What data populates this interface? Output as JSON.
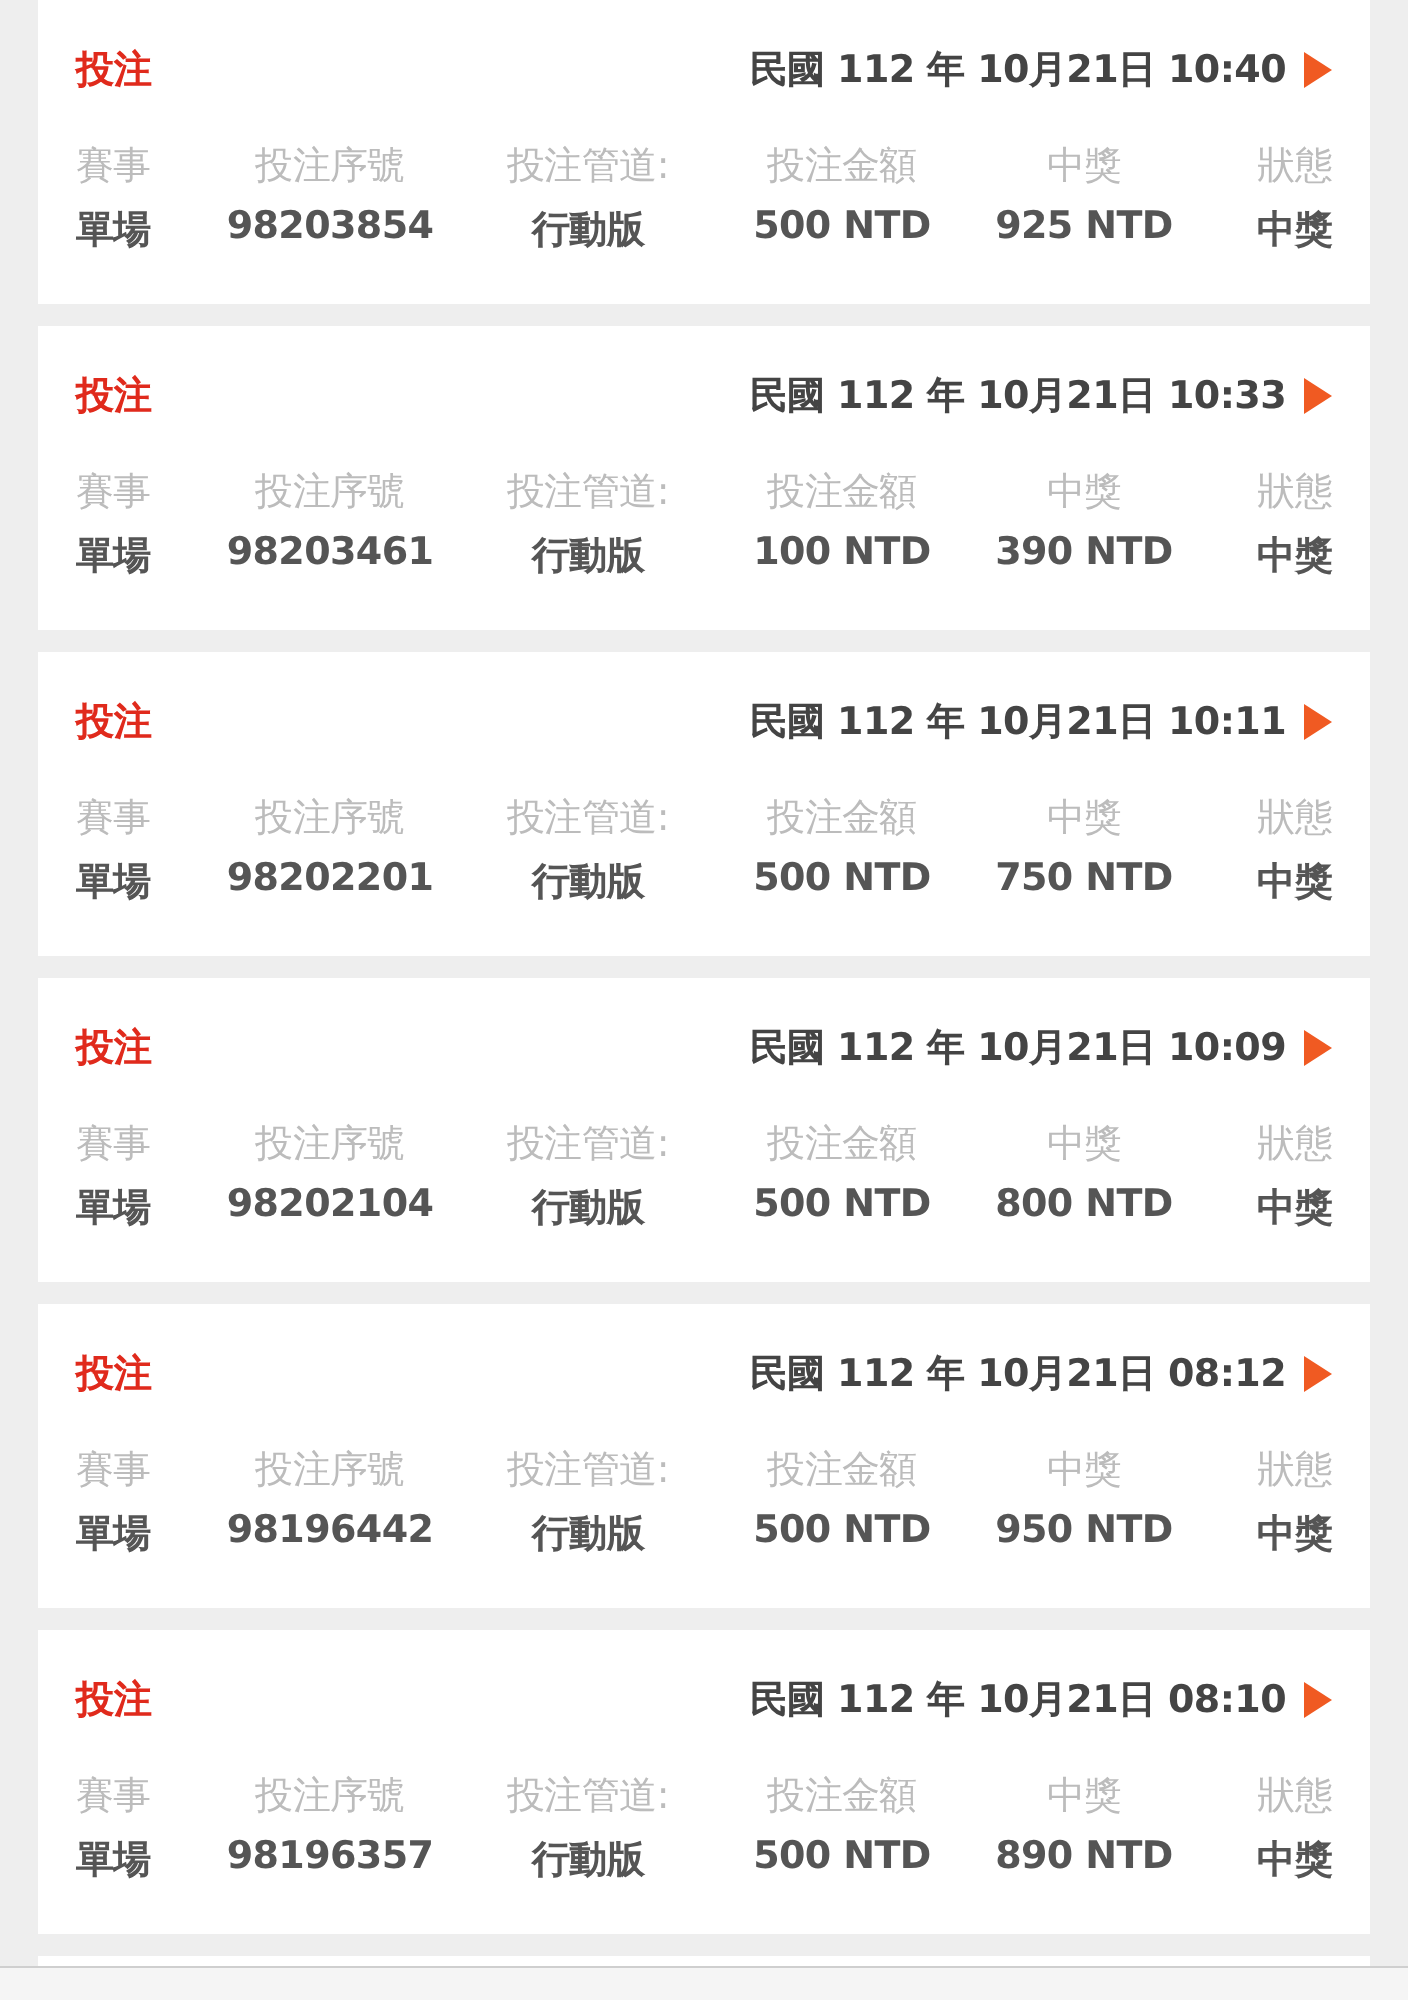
{
  "bets": [
    {
      "type": "投注",
      "datetime": "民國 112 年 10月21日 10:40",
      "columns": [
        "賽事",
        "投注序號",
        "投注管道:",
        "投注金額",
        "中獎",
        "狀態"
      ],
      "values": [
        "單場",
        "98203854",
        "行動版",
        "500 NTD",
        "925 NTD",
        "中獎"
      ]
    },
    {
      "type": "投注",
      "datetime": "民國 112 年 10月21日 10:33",
      "columns": [
        "賽事",
        "投注序號",
        "投注管道:",
        "投注金額",
        "中獎",
        "狀態"
      ],
      "values": [
        "單場",
        "98203461",
        "行動版",
        "100 NTD",
        "390 NTD",
        "中獎"
      ]
    },
    {
      "type": "投注",
      "datetime": "民國 112 年 10月21日 10:11",
      "columns": [
        "賽事",
        "投注序號",
        "投注管道:",
        "投注金額",
        "中獎",
        "狀態"
      ],
      "values": [
        "單場",
        "98202201",
        "行動版",
        "500 NTD",
        "750 NTD",
        "中獎"
      ]
    },
    {
      "type": "投注",
      "datetime": "民國 112 年 10月21日 10:09",
      "columns": [
        "賽事",
        "投注序號",
        "投注管道:",
        "投注金額",
        "中獎",
        "狀態"
      ],
      "values": [
        "單場",
        "98202104",
        "行動版",
        "500 NTD",
        "800 NTD",
        "中獎"
      ]
    },
    {
      "type": "投注",
      "datetime": "民國 112 年 10月21日 08:12",
      "columns": [
        "賽事",
        "投注序號",
        "投注管道:",
        "投注金額",
        "中獎",
        "狀態"
      ],
      "values": [
        "單場",
        "98196442",
        "行動版",
        "500 NTD",
        "950 NTD",
        "中獎"
      ]
    },
    {
      "type": "投注",
      "datetime": "民國 112 年 10月21日 08:10",
      "columns": [
        "賽事",
        "投注序號",
        "投注管道:",
        "投注金額",
        "中獎",
        "狀態"
      ],
      "values": [
        "單場",
        "98196357",
        "行動版",
        "500 NTD",
        "890 NTD",
        "中獎"
      ]
    }
  ]
}
